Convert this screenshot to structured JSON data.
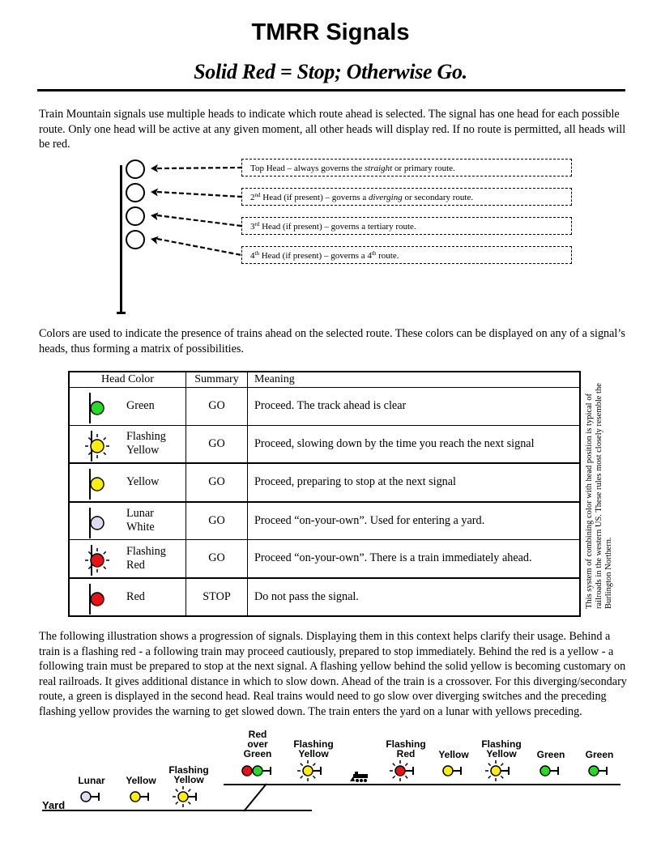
{
  "header": {
    "title": "TMRR Signals",
    "subtitle": "Solid Red = Stop; Otherwise Go."
  },
  "intro_paragraph": "Train Mountain signals use multiple heads to indicate which route ahead is selected.  The signal has one head for each possible route.  Only one head will be active at any given moment, all other heads will display red.  If no route is permitted, all heads will be red.",
  "heads_diagram": {
    "callouts": [
      {
        "pre": "Top Head – always governs the ",
        "em": "straight",
        "post": " or primary route.",
        "num": "",
        "sup": ""
      },
      {
        "pre": " Head (if present) – governs a ",
        "em": "diverging",
        "post": " or secondary route.",
        "num": "2",
        "sup": "nd"
      },
      {
        "pre": " Head (if present) – governs a tertiary route.",
        "em": "",
        "post": "",
        "num": "3",
        "sup": "rd"
      },
      {
        "pre": " Head (if present) – governs a 4",
        "em": "",
        "post": " route.",
        "num": "4",
        "sup": "th",
        "post_sup": "th"
      }
    ]
  },
  "colors_paragraph": "Colors are used to indicate the presence of trains ahead on the selected route.   These colors can be displayed on any of a signal’s heads, thus forming a matrix of possibilities.",
  "table": {
    "headers": {
      "head_color": "Head Color",
      "summary": "Summary",
      "meaning": "Meaning"
    },
    "rows": [
      {
        "color_name": "Green",
        "lamp": "#22dd22",
        "flashing": false,
        "summary": "GO",
        "meaning": "Proceed.  The track ahead is clear"
      },
      {
        "color_name": "Flashing Yellow",
        "lamp": "#ffee00",
        "flashing": true,
        "summary": "GO",
        "meaning": "Proceed, slowing down by the time you reach the next signal"
      },
      {
        "color_name": "Yellow",
        "lamp": "#ffee00",
        "flashing": false,
        "summary": "GO",
        "meaning": "Proceed, preparing to stop at the next signal"
      },
      {
        "color_name": "Lunar White",
        "lamp": "#dcdcf0",
        "flashing": false,
        "summary": "GO",
        "meaning": "Proceed “on-your-own”.  Used for entering a yard."
      },
      {
        "color_name": "Flashing Red",
        "lamp": "#ee1111",
        "flashing": true,
        "summary": "GO",
        "meaning": "Proceed “on-your-own”.  There is a train immediately ahead."
      },
      {
        "color_name": "Red",
        "lamp": "#ee1111",
        "flashing": false,
        "summary": "STOP",
        "meaning": "Do not pass the signal."
      }
    ]
  },
  "side_note": "This system of combining color with head position is typical of railroads in the western US.  These rules most closely resemble the Burlington Northern.",
  "progression_paragraph": "The following illustration shows a progression of signals.  Displaying them in this context helps clarify their usage.  Behind a train is a flashing red - a following train may proceed cautiously, prepared to stop immediately.  Behind the red is a yellow - a following train must be prepared to stop at the next signal.  A flashing yellow behind the solid yellow is becoming customary on real railroads.  It gives additional distance in which to slow down.  Ahead of the train is a crossover.  For this diverging/secondary route, a green is displayed in the second head.  Real trains would need to go slow over diverging switches and the preceding flashing yellow provides the warning to get slowed down.  The train enters the yard on a lunar with yellows preceding.",
  "illustration": {
    "yard_label": "Yard",
    "signals": [
      {
        "label": "Lunar",
        "lamps": [
          "#dcdcf0"
        ],
        "flashing": false
      },
      {
        "label": "Yellow",
        "lamps": [
          "#ffee00"
        ],
        "flashing": false
      },
      {
        "label": "Flashing Yellow",
        "lamps": [
          "#ffee00"
        ],
        "flashing": true
      },
      {
        "label": "Red over Green",
        "lamps": [
          "#ee1111",
          "#22dd22"
        ],
        "flashing": false
      },
      {
        "label": "Flashing Yellow",
        "lamps": [
          "#ffee00"
        ],
        "flashing": true
      },
      {
        "label": "Flashing Red",
        "lamps": [
          "#ee1111"
        ],
        "flashing": true
      },
      {
        "label": "Yellow",
        "lamps": [
          "#ffee00"
        ],
        "flashing": false
      },
      {
        "label": "Flashing Yellow",
        "lamps": [
          "#ffee00"
        ],
        "flashing": true
      },
      {
        "label": "Green",
        "lamps": [
          "#22dd22"
        ],
        "flashing": false
      },
      {
        "label": "Green",
        "lamps": [
          "#22dd22"
        ],
        "flashing": false
      }
    ],
    "train_icon": "locomotive-icon"
  }
}
